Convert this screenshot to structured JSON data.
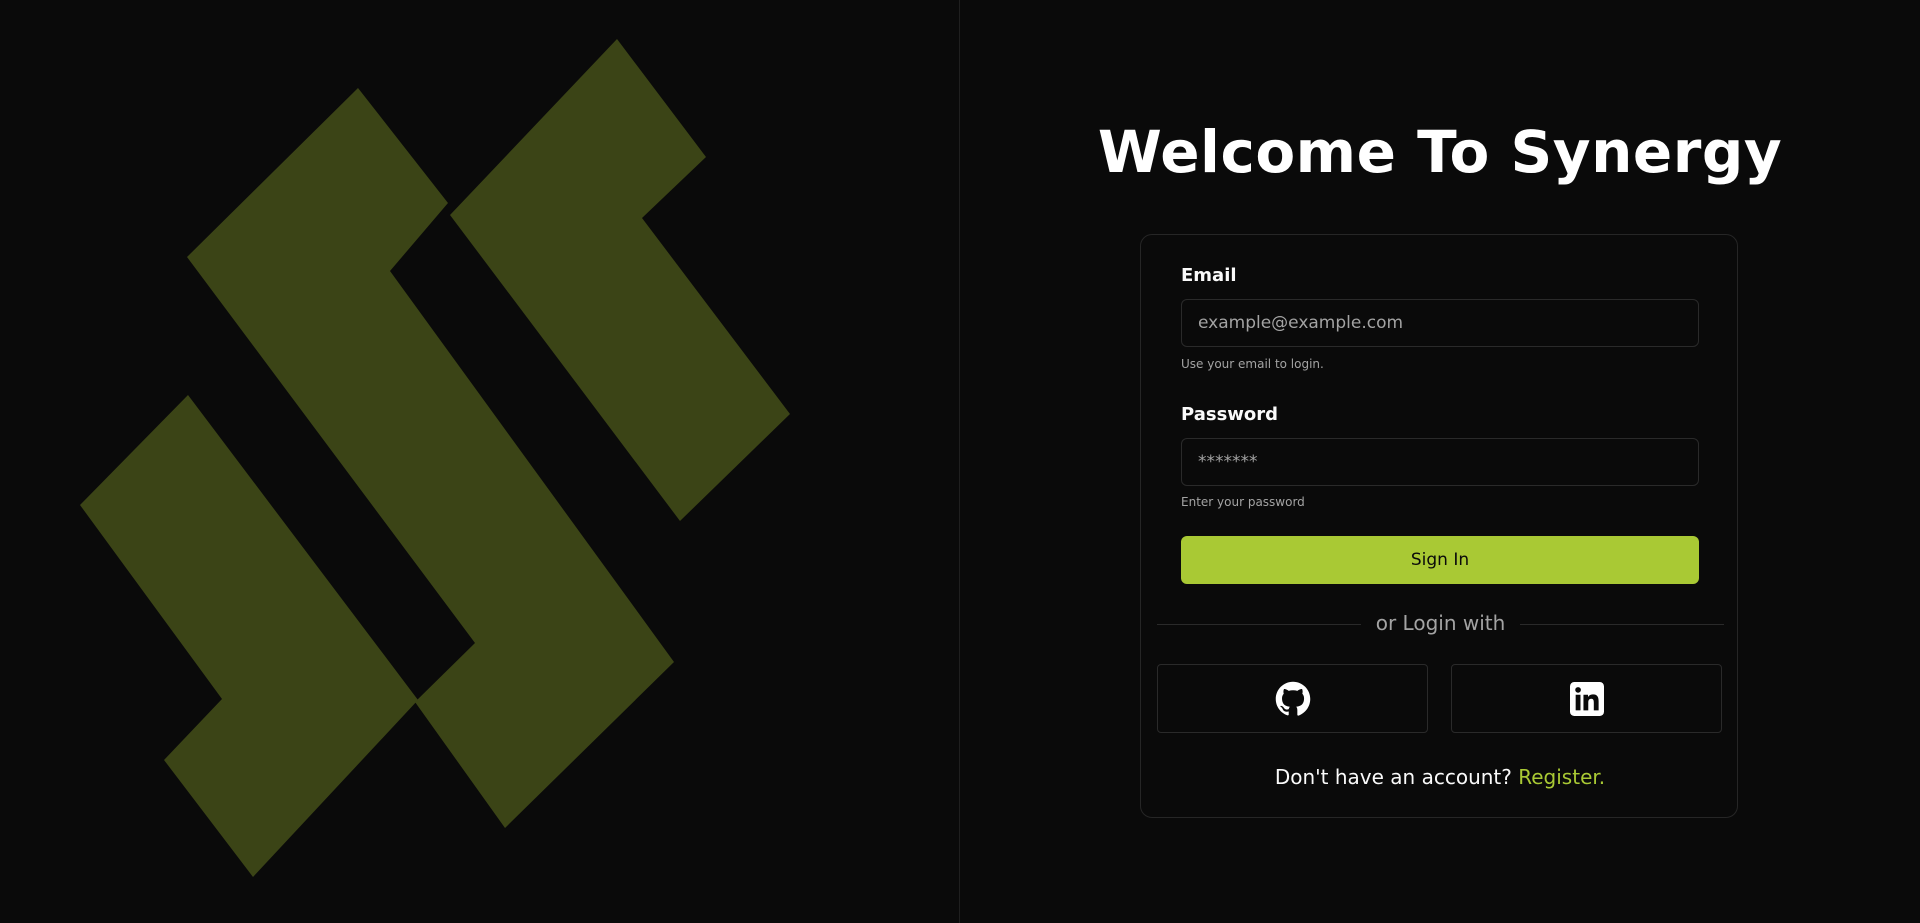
{
  "header": {
    "title": "Welcome To Synergy"
  },
  "brand": {
    "logo_color": "#3b4416",
    "accent_color": "#a9c934",
    "logo_icon": "synergy-logo"
  },
  "form": {
    "email": {
      "label": "Email",
      "placeholder": "example@example.com",
      "value": "",
      "helper": "Use your email to login."
    },
    "password": {
      "label": "Password",
      "placeholder": "*******",
      "value": "",
      "helper": "Enter your password"
    },
    "submit_label": "Sign In"
  },
  "social": {
    "divider_text": "or Login with",
    "providers": [
      {
        "name": "GitHub",
        "icon": "github-icon"
      },
      {
        "name": "LinkedIn",
        "icon": "linkedin-icon"
      }
    ]
  },
  "footer": {
    "prompt": "Don't have an account?",
    "register_label": "Register."
  }
}
